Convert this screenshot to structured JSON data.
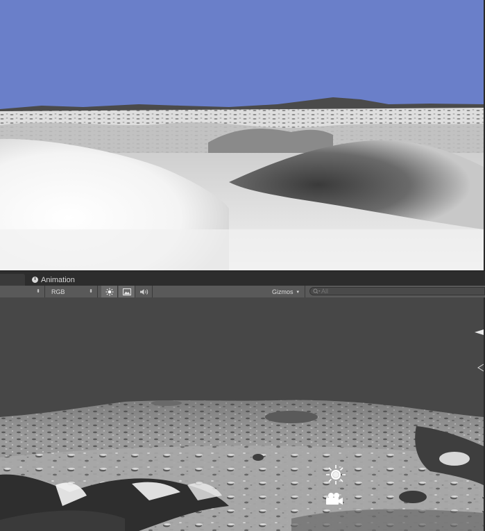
{
  "game_view": {
    "sky_color": "#6a7fc9",
    "terrain": "moon-surface-lit"
  },
  "tabs": {
    "inactive_tab_label": "",
    "animation_label": "Animation",
    "animation_icon": "clock-icon"
  },
  "toolbar": {
    "render_mode_arrows": "⬍",
    "rgb_label": "RGB",
    "rgb_arrows": "⬍",
    "lighting_icon": "sun-icon",
    "image_icon": "image-icon",
    "audio_icon": "speaker-icon",
    "gizmos_label": "Gizmos",
    "gizmos_arrow": "▾",
    "search_placeholder": "All"
  },
  "scene_view": {
    "background": "#474747",
    "terrain": "moon-surface-gray",
    "light_gizmo": "sun-icon",
    "camera_gizmo": "camera-icon"
  },
  "colors": {
    "toolbar": "#595959",
    "tabbar": "#2d2d2d",
    "panel": "#474747"
  }
}
